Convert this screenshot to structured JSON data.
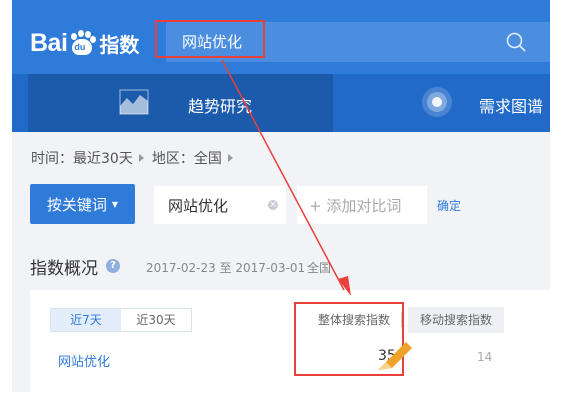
{
  "header": {
    "logo_bai": "Bai",
    "logo_du": "du",
    "logo_suffix": "指数",
    "search_value": "网站优化"
  },
  "tabs": [
    {
      "label": "趋势研究",
      "active": true
    },
    {
      "label": "需求图谱",
      "active": false
    }
  ],
  "filters": {
    "time": "时间：最近30天",
    "region": "地区：全国"
  },
  "keyword_bar": {
    "button_label": "按关键词",
    "keyword": "网站优化",
    "add_compare": "+ 添加对比词",
    "confirm": "确定"
  },
  "overview": {
    "title": "指数概况",
    "help": "?",
    "date_range": "2017-02-23 至 2017-03-01",
    "region": "全国",
    "periods": [
      {
        "label": "近7天",
        "active": true
      },
      {
        "label": "近30天",
        "active": false
      }
    ],
    "columns": [
      "整体搜索指数",
      "移动搜索指数"
    ],
    "row": {
      "keyword": "网站优化",
      "overall": "35",
      "mobile": "14"
    }
  },
  "colors": {
    "brand_blue": "#2f7bd9",
    "tab_bar": "#216ac8",
    "tab_active": "#1c5aab",
    "annotation_red": "#e8403b"
  }
}
